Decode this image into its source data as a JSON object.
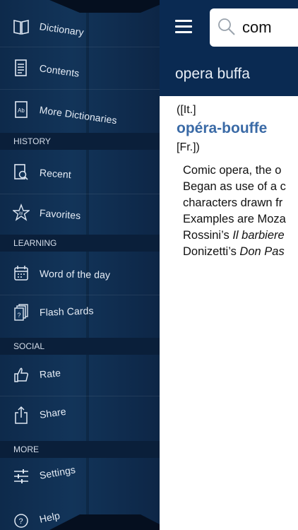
{
  "menu": {
    "items": [
      {
        "label": "Dictionary",
        "icon": "book-icon"
      },
      {
        "label": "Contents",
        "icon": "document-icon"
      },
      {
        "label": "More Dictionaries",
        "icon": "ab-book-icon"
      },
      {
        "label": "Recent",
        "icon": "recent-doc-icon"
      },
      {
        "label": "Favorites",
        "icon": "star-w-icon"
      },
      {
        "label": "Word of the day",
        "icon": "calendar-icon"
      },
      {
        "label": "Flash Cards",
        "icon": "flash-cards-icon"
      },
      {
        "label": "Rate",
        "icon": "thumbs-up-icon"
      },
      {
        "label": "Share",
        "icon": "share-icon"
      },
      {
        "label": "Settings",
        "icon": "sliders-icon"
      },
      {
        "label": "Help",
        "icon": "help-icon"
      }
    ],
    "sections": {
      "history": "HISTORY",
      "learning": "LEARNING",
      "social": "SOCIAL",
      "more": "MORE"
    }
  },
  "search": {
    "value": "com"
  },
  "entry": {
    "title": "opera buffa",
    "origin_it": "([It.]",
    "variant": "opéra-bouffe",
    "origin_fr": "[Fr.])",
    "definition": {
      "line1": "Comic opera, the o",
      "line2": "Began as use of a c",
      "line3": "characters drawn fr",
      "line4": "Examples are Moza",
      "line5_pre": "Rossini’s ",
      "line5_em": "Il barbiere",
      "line6_pre": "Donizetti’s ",
      "line6_em": "Don Pas"
    }
  },
  "colors": {
    "header_bg": "#0a2a52",
    "menu_bg": "#123459",
    "link_blue": "#3a6aa6"
  }
}
